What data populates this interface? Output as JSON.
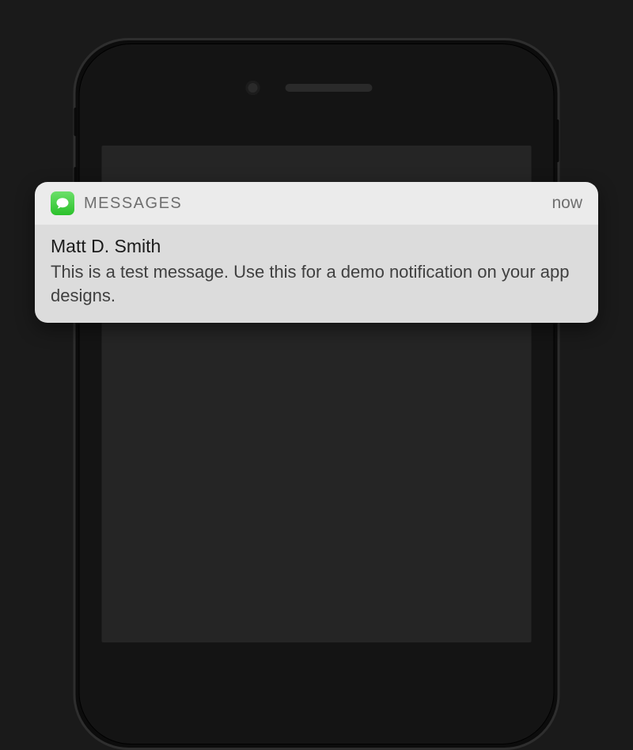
{
  "notification": {
    "app_name": "MESSAGES",
    "timestamp": "now",
    "sender": "Matt D. Smith",
    "message": "This is a test message. Use this for a demo notification on your app designs."
  }
}
